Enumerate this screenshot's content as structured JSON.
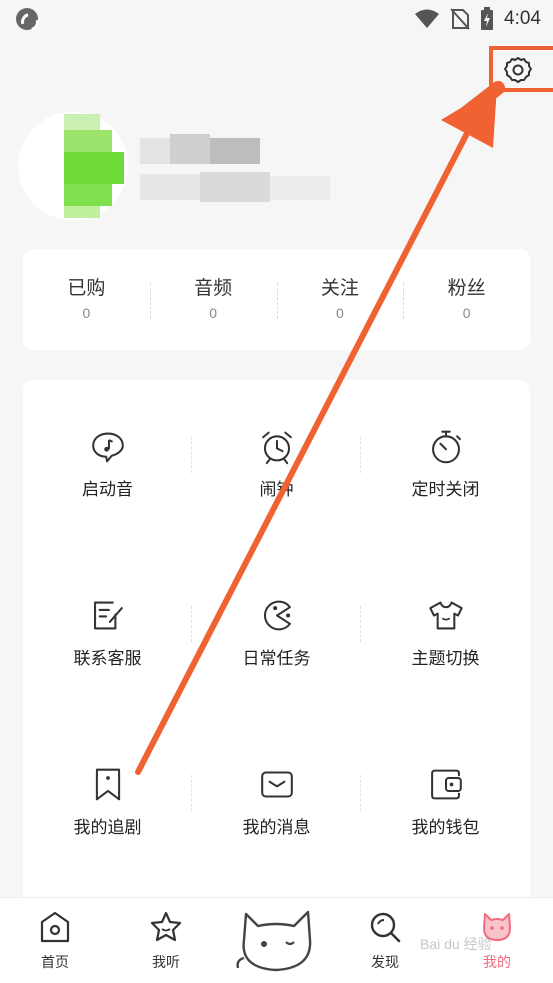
{
  "status_bar": {
    "time": "4:04"
  },
  "header": {
    "settings_icon": "gear-icon"
  },
  "stats": [
    {
      "label": "已购",
      "value": "0"
    },
    {
      "label": "音频",
      "value": "0"
    },
    {
      "label": "关注",
      "value": "0"
    },
    {
      "label": "粉丝",
      "value": "0"
    }
  ],
  "grid": [
    {
      "label": "启动音",
      "icon": "speech-bubble-music-icon"
    },
    {
      "label": "闹钟",
      "icon": "alarm-clock-icon"
    },
    {
      "label": "定时关闭",
      "icon": "stopwatch-icon"
    },
    {
      "label": "联系客服",
      "icon": "edit-note-icon"
    },
    {
      "label": "日常任务",
      "icon": "pacman-icon"
    },
    {
      "label": "主题切换",
      "icon": "tshirt-icon"
    },
    {
      "label": "我的追剧",
      "icon": "bookmark-icon"
    },
    {
      "label": "我的消息",
      "icon": "envelope-icon"
    },
    {
      "label": "我的钱包",
      "icon": "wallet-icon"
    }
  ],
  "nav": [
    {
      "label": "首页",
      "icon": "home-icon"
    },
    {
      "label": "我听",
      "icon": "star-icon"
    },
    {
      "label": "发现",
      "icon": "search-icon"
    },
    {
      "label": "我的",
      "icon": "cat-profile-icon"
    }
  ],
  "colors": {
    "accent": "#f36b7d",
    "annotation": "#f06232"
  },
  "watermark": "Bai du 经验"
}
